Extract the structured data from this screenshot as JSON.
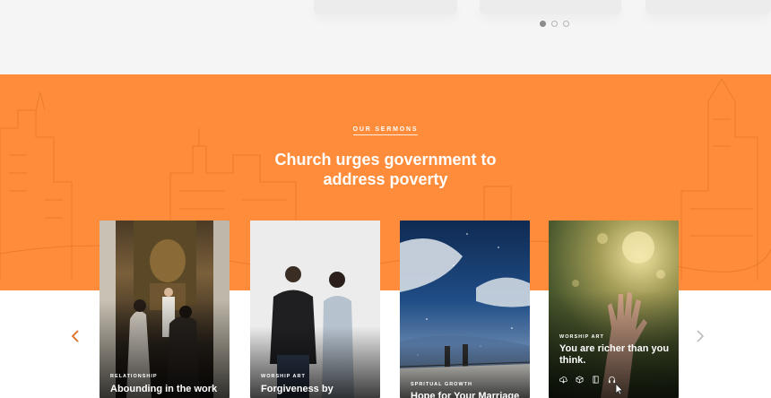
{
  "section": {
    "eyebrow": "OUR SERMONS",
    "headline_line1": "Church urges government to",
    "headline_line2": "address poverty"
  },
  "carousel": {
    "dots": [
      true,
      false,
      false
    ],
    "prev_icon": "chevron-left-icon",
    "next_icon": "chevron-right-icon"
  },
  "cards": [
    {
      "category": "RELATIONSHIP",
      "title": "Abounding in the work"
    },
    {
      "category": "WORSHIP ART",
      "title": "Forgiveness by"
    },
    {
      "category": "SPRITUAL GROWTH",
      "title": "Hope for Your Marriage"
    },
    {
      "category": "WORSHIP ART",
      "title": "You are richer than you think.",
      "actions": [
        "cloud-download-icon",
        "cube-icon",
        "book-icon",
        "headphones-icon"
      ]
    }
  ],
  "colors": {
    "accent": "#ff8c3a",
    "top_bg": "#f5f5f5"
  }
}
